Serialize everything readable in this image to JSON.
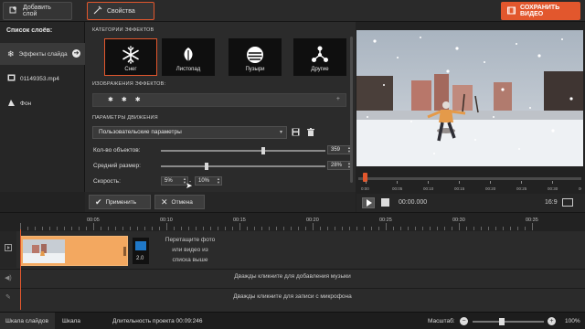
{
  "toolbar": {
    "add_layer_label": "Добавить слой",
    "properties_label": "Свойства",
    "save_video_label": "СОХРАНИТЬ ВИДЕО"
  },
  "layers": {
    "title": "Список слоёв:",
    "items": [
      {
        "label": "Эффекты слайда",
        "icon": "snowflake-icon",
        "active": true
      },
      {
        "label": "01149353.mp4",
        "icon": "film-icon",
        "active": false
      },
      {
        "label": "Фон",
        "icon": "background-icon",
        "active": false
      }
    ]
  },
  "effects": {
    "categories_title": "КАТЕГОРИИ ЭФФЕКТОВ",
    "categories": [
      {
        "label": "Снег",
        "icon": "snowflake-icon",
        "selected": true
      },
      {
        "label": "Листопад",
        "icon": "leaf-icon",
        "selected": false
      },
      {
        "label": "Пузыри",
        "icon": "bubble-icon",
        "selected": false
      },
      {
        "label": "Другие",
        "icon": "network-icon",
        "selected": false
      }
    ],
    "images_title": "ИЗОБРАЖЕНИЯ ЭФФЕКТОВ:",
    "motion_title": "ПАРАМЕТРЫ ДВИЖЕНИЯ",
    "preset_value": "Пользовательские параметры",
    "object_count_label": "Кол-во объектов:",
    "object_count_value": "359",
    "object_count_level": 0.62,
    "avg_size_label": "Средний размер:",
    "avg_size_value": "28%",
    "avg_size_level": 0.28,
    "speed_label": "Скорость:",
    "speed_min": "5%",
    "speed_separator": "-",
    "speed_max": "10%"
  },
  "actions": {
    "apply_label": "Применить",
    "cancel_label": "Отмена"
  },
  "player": {
    "time": "00:00.000",
    "aspect": "16:9",
    "scrub_ticks": [
      "0:00",
      "00:05",
      "00:10",
      "00:15",
      "00:20",
      "00:25",
      "00:30",
      "00:35"
    ],
    "progress": 0.0
  },
  "timeline": {
    "ruler_ticks": [
      "00:05",
      "00:10",
      "00:15",
      "00:20",
      "00:25",
      "00:30",
      "00:35"
    ],
    "drop_hint": "Перетащите фото или видео из списка выше",
    "transition_duration": "2.0",
    "music_hint": "Дважды кликните для добавления музыки",
    "mic_hint": "Дважды кликните для записи с микрофона"
  },
  "bottombar": {
    "tab_slides": "Шкала слайдов",
    "tab_timeline": "Шкала времени",
    "duration_label": "Длительность проекта 00:09:246",
    "zoom_label": "Масштаб:",
    "zoom_value": "100%",
    "zoom_level": 0.4
  },
  "colors": {
    "accent": "#e2572d",
    "clip": "#f3a860"
  }
}
